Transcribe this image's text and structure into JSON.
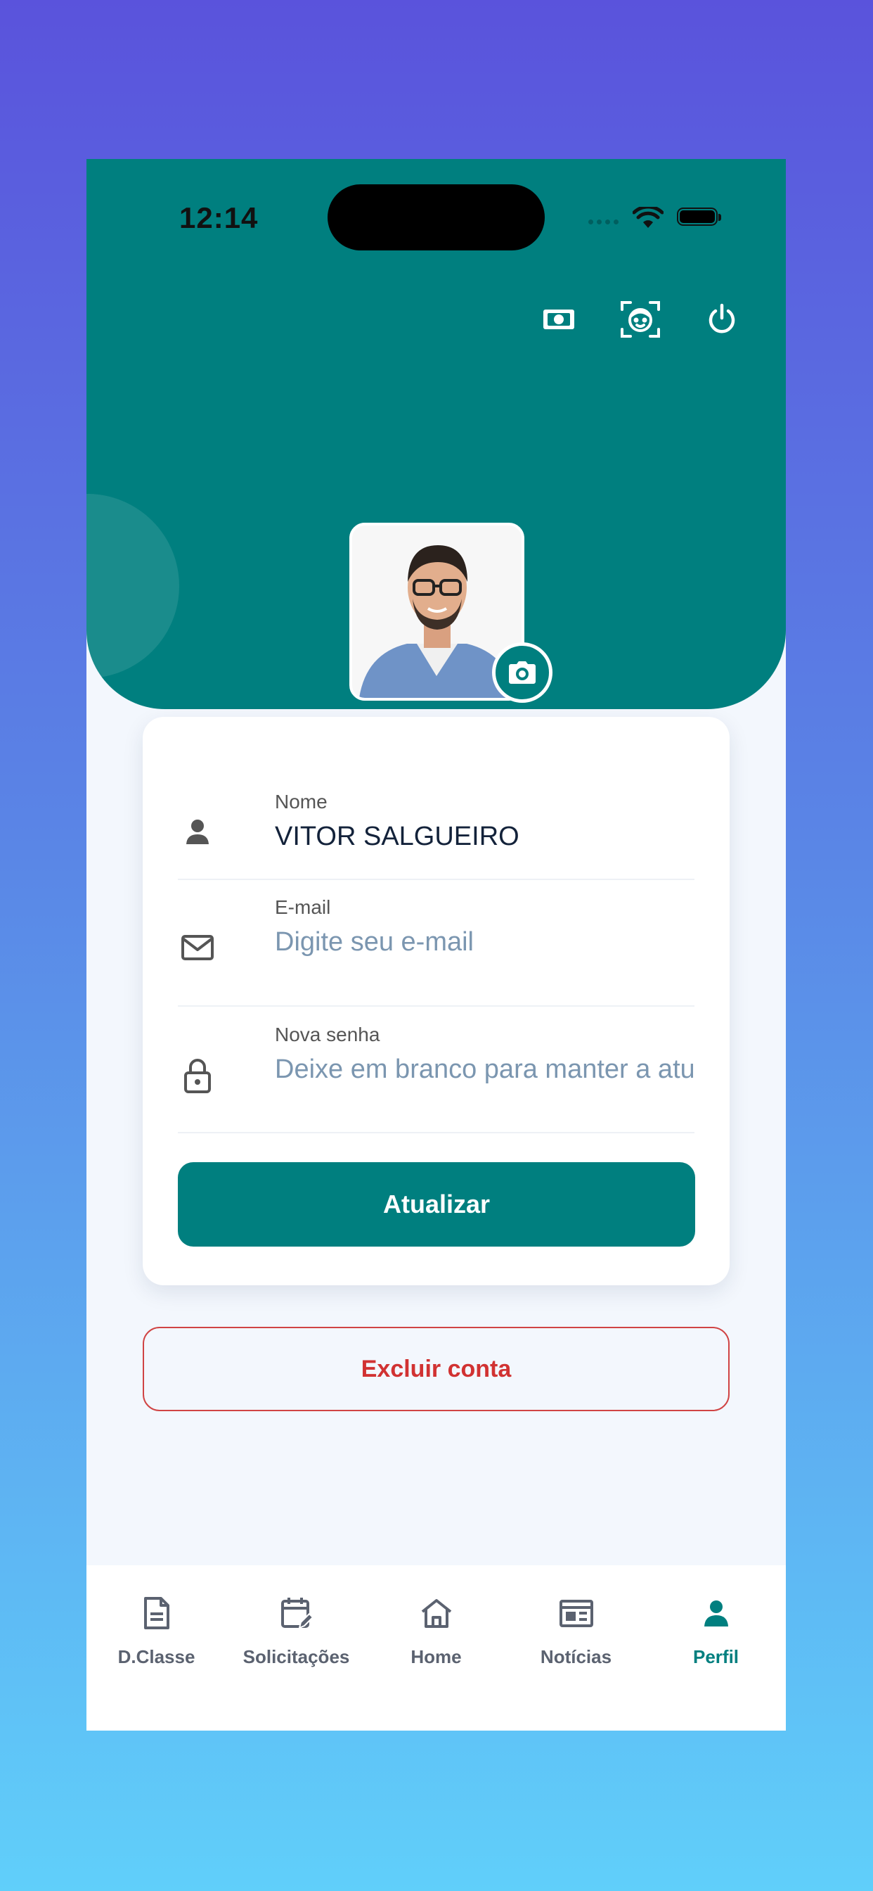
{
  "status_bar": {
    "time": "12:14"
  },
  "header": {
    "actions": [
      {
        "icon": "money-icon"
      },
      {
        "icon": "face-scan-icon"
      },
      {
        "icon": "power-icon"
      }
    ],
    "avatar": {
      "alt": "profile-photo"
    }
  },
  "form": {
    "name": {
      "label": "Nome",
      "value": "VITOR SALGUEIRO"
    },
    "email": {
      "label": "E-mail",
      "value": "",
      "placeholder": "Digite seu e-mail"
    },
    "password": {
      "label": "Nova senha",
      "value": "",
      "placeholder": "Deixe em branco para manter a atual"
    },
    "submit_label": "Atualizar"
  },
  "delete_account_label": "Excluir conta",
  "tabbar": {
    "items": [
      {
        "label": "D.Classe",
        "icon": "document-icon",
        "active": false
      },
      {
        "label": "Solicitações",
        "icon": "calendar-edit-icon",
        "active": false
      },
      {
        "label": "Home",
        "icon": "home-icon",
        "active": false
      },
      {
        "label": "Notícias",
        "icon": "newspaper-icon",
        "active": false
      },
      {
        "label": "Perfil",
        "icon": "person-icon",
        "active": true
      }
    ]
  },
  "colors": {
    "primary": "#007f7f",
    "danger": "#d13232",
    "background": "#f3f7fd",
    "tab_inactive": "#5b6270"
  }
}
